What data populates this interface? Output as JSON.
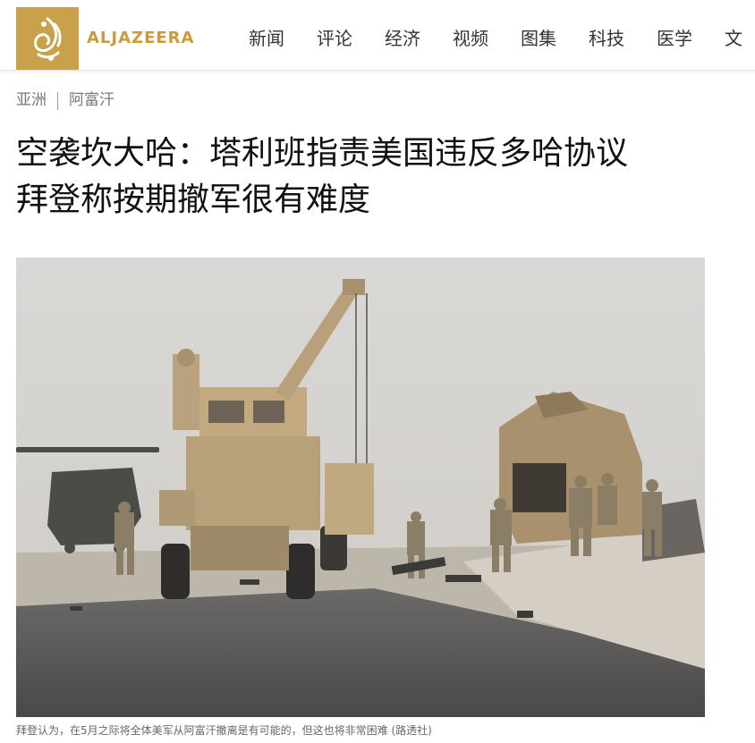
{
  "header": {
    "logo_text": "ALJAZEERA",
    "nav": [
      "新闻",
      "评论",
      "经济",
      "视频",
      "图集",
      "科技",
      "医学",
      "文"
    ]
  },
  "breadcrumb": [
    "亚洲",
    "阿富汗"
  ],
  "article": {
    "title_line1": "空袭坎大哈：塔利班指责美国违反多哈协议",
    "title_line2": "拜登称按期撤军很有难度",
    "caption": "拜登认为，在5月之际将全体美军从阿富汗撤离是有可能的，但这也将非常困难 (路透社)"
  },
  "colors": {
    "brand": "#c9a14a",
    "brand_text": "#c99b3b"
  }
}
